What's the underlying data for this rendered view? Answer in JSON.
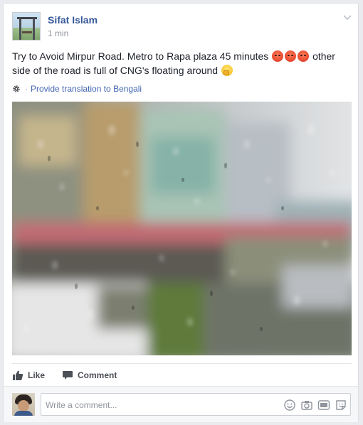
{
  "post": {
    "author": "Sifat Islam",
    "time": "1 min",
    "text_part1": "Try to Avoid Mirpur Road. Metro to Rapa plaza 45 minutes",
    "text_part2": "other side of the road is full of CNG's floating around",
    "translate_link": "Provide translation to Bengali"
  },
  "actions": {
    "like_label": "Like",
    "comment_label": "Comment"
  },
  "comment_box": {
    "placeholder": "Write a comment..."
  },
  "icons": {
    "options": "chevron-down-icon",
    "translate": "gear-icon",
    "like": "thumbs-up-icon",
    "comment": "speech-bubble-icon",
    "emoji": "smiley-icon",
    "photo": "camera-icon",
    "gif": "gif-icon",
    "sticker": "sticker-icon"
  },
  "colors": {
    "author_link": "#365899",
    "link": "#4267b2",
    "meta": "#90949c",
    "text": "#1d2129"
  }
}
